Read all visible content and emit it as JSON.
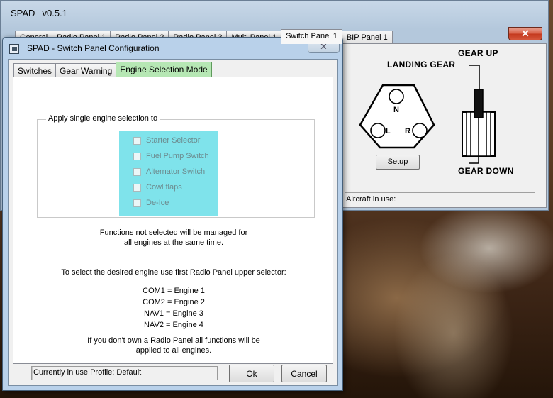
{
  "background_window": {
    "title": "SPAD",
    "version": "v0.5.1",
    "tabs": [
      {
        "label": "General"
      },
      {
        "label": "Radio Panel 1"
      },
      {
        "label": "Radio Panel 2"
      },
      {
        "label": "Radio Panel 3"
      },
      {
        "label": "Multi Panel 1"
      },
      {
        "label": "Switch Panel 1"
      },
      {
        "label": "BIP Panel 1"
      }
    ],
    "active_tab": "Switch Panel 1",
    "close_glyph": "✕",
    "switch_panel": {
      "landing_gear_label": "LANDING GEAR",
      "gear_up_label": "GEAR UP",
      "gear_down_label": "GEAR DOWN",
      "light_nose": "N",
      "light_left": "L",
      "light_right": "R",
      "setup_button": "Setup",
      "aircraft_label": "Aircraft in use:"
    }
  },
  "dialog": {
    "title": "SPAD - Switch Panel Configuration",
    "close_glyph": "✕",
    "tabs": [
      {
        "label": "Switches"
      },
      {
        "label": "Gear Warning"
      },
      {
        "label": "Engine Selection Mode"
      }
    ],
    "active_tab": "Engine Selection Mode",
    "groupbox_label": "Apply single engine selection to",
    "options": [
      {
        "label": "Starter Selector",
        "checked": false
      },
      {
        "label": "Fuel Pump Switch",
        "checked": false
      },
      {
        "label": "Alternator Switch",
        "checked": false
      },
      {
        "label": "Cowl flaps",
        "checked": false
      },
      {
        "label": "De-Ice",
        "checked": false
      }
    ],
    "info_managed": [
      "Functions not selected will be managed for",
      "all engines at the same time."
    ],
    "info_select": "To select the desired engine use first Radio Panel upper selector:",
    "mappings": [
      "COM1 = Engine 1",
      "COM2 = Engine 2",
      "NAV1 = Engine 3",
      "NAV2 = Engine 4"
    ],
    "info_no_radio": [
      "If you don't own a Radio Panel all functions will be",
      "applied to all engines."
    ],
    "profile_status": "Currently in use Profile:  Default",
    "ok_button": "Ok",
    "cancel_button": "Cancel"
  },
  "colors": {
    "active_tab_green": "#b6e7b4",
    "option_highlight_cyan": "#7fe3eb",
    "close_red": "#c4391e"
  }
}
